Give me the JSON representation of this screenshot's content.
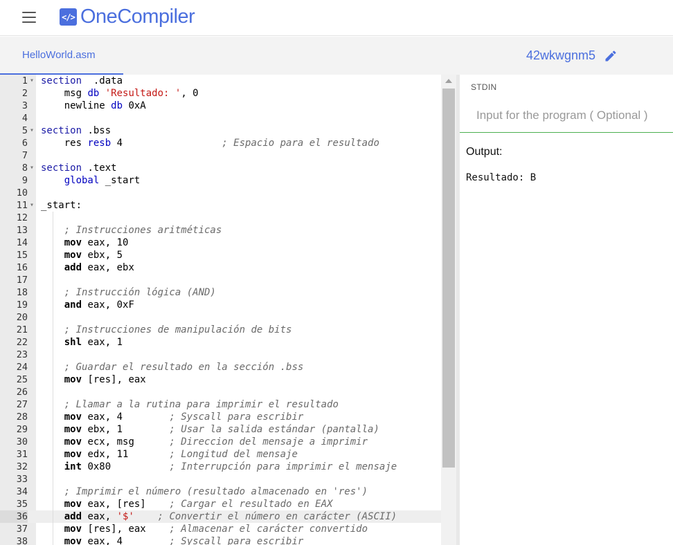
{
  "header": {
    "logo_glyph": "</>",
    "brand": "OneCompiler",
    "accent_color": "#4b6fde"
  },
  "subbar": {
    "file_tab": "HelloWorld.asm",
    "project_id": "42wkwgnm5"
  },
  "editor": {
    "lines": [
      {
        "n": "1",
        "fold": true,
        "tokens": [
          [
            "sec",
            "section"
          ],
          [
            "",
            "  .data"
          ]
        ]
      },
      {
        "n": "2",
        "tokens": [
          [
            "",
            "    msg "
          ],
          [
            "kw",
            "db"
          ],
          [
            "",
            ""
          ],
          [
            "str",
            " 'Resultado: '"
          ],
          [
            "",
            ", 0"
          ]
        ]
      },
      {
        "n": "3",
        "tokens": [
          [
            "",
            "    newline "
          ],
          [
            "kw",
            "db"
          ],
          [
            "",
            " 0xA"
          ]
        ]
      },
      {
        "n": "4",
        "tokens": []
      },
      {
        "n": "5",
        "fold": true,
        "tokens": [
          [
            "sec",
            "section"
          ],
          [
            "",
            " .bss"
          ]
        ]
      },
      {
        "n": "6",
        "tokens": [
          [
            "",
            "    res "
          ],
          [
            "kw",
            "resb"
          ],
          [
            "",
            " 4                 "
          ],
          [
            "cm",
            "; Espacio para el resultado"
          ]
        ]
      },
      {
        "n": "7",
        "tokens": []
      },
      {
        "n": "8",
        "fold": true,
        "tokens": [
          [
            "sec",
            "section"
          ],
          [
            "",
            " .text"
          ]
        ]
      },
      {
        "n": "9",
        "tokens": [
          [
            "",
            "    "
          ],
          [
            "kw",
            "global"
          ],
          [
            "",
            " _start"
          ]
        ]
      },
      {
        "n": "10",
        "tokens": []
      },
      {
        "n": "11",
        "fold": true,
        "tokens": [
          [
            "",
            "_start:"
          ]
        ]
      },
      {
        "n": "12",
        "tokens": []
      },
      {
        "n": "13",
        "tokens": [
          [
            "",
            "    "
          ],
          [
            "cm",
            "; Instrucciones aritméticas"
          ]
        ]
      },
      {
        "n": "14",
        "tokens": [
          [
            "",
            "    "
          ],
          [
            "ins",
            "mov"
          ],
          [
            "",
            " eax, 10"
          ]
        ]
      },
      {
        "n": "15",
        "tokens": [
          [
            "",
            "    "
          ],
          [
            "ins",
            "mov"
          ],
          [
            "",
            " ebx, 5"
          ]
        ]
      },
      {
        "n": "16",
        "tokens": [
          [
            "",
            "    "
          ],
          [
            "ins",
            "add"
          ],
          [
            "",
            " eax, ebx"
          ]
        ]
      },
      {
        "n": "17",
        "tokens": []
      },
      {
        "n": "18",
        "tokens": [
          [
            "",
            "    "
          ],
          [
            "cm",
            "; Instrucción lógica (AND)"
          ]
        ]
      },
      {
        "n": "19",
        "tokens": [
          [
            "",
            "    "
          ],
          [
            "ins",
            "and"
          ],
          [
            "",
            " eax, 0xF"
          ]
        ]
      },
      {
        "n": "20",
        "tokens": []
      },
      {
        "n": "21",
        "tokens": [
          [
            "",
            "    "
          ],
          [
            "cm",
            "; Instrucciones de manipulación de bits"
          ]
        ]
      },
      {
        "n": "22",
        "tokens": [
          [
            "",
            "    "
          ],
          [
            "ins",
            "shl"
          ],
          [
            "",
            " eax, 1"
          ]
        ]
      },
      {
        "n": "23",
        "tokens": []
      },
      {
        "n": "24",
        "tokens": [
          [
            "",
            "    "
          ],
          [
            "cm",
            "; Guardar el resultado en la sección .bss"
          ]
        ]
      },
      {
        "n": "25",
        "tokens": [
          [
            "",
            "    "
          ],
          [
            "ins",
            "mov"
          ],
          [
            "",
            " [res], eax"
          ]
        ]
      },
      {
        "n": "26",
        "tokens": []
      },
      {
        "n": "27",
        "tokens": [
          [
            "",
            "    "
          ],
          [
            "cm",
            "; Llamar a la rutina para imprimir el resultado"
          ]
        ]
      },
      {
        "n": "28",
        "tokens": [
          [
            "",
            "    "
          ],
          [
            "ins",
            "mov"
          ],
          [
            "",
            " eax, 4        "
          ],
          [
            "cm",
            "; Syscall para escribir"
          ]
        ]
      },
      {
        "n": "29",
        "tokens": [
          [
            "",
            "    "
          ],
          [
            "ins",
            "mov"
          ],
          [
            "",
            " ebx, 1        "
          ],
          [
            "cm",
            "; Usar la salida estándar (pantalla)"
          ]
        ]
      },
      {
        "n": "30",
        "tokens": [
          [
            "",
            "    "
          ],
          [
            "ins",
            "mov"
          ],
          [
            "",
            " ecx, msg      "
          ],
          [
            "cm",
            "; Direccion del mensaje a imprimir"
          ]
        ]
      },
      {
        "n": "31",
        "tokens": [
          [
            "",
            "    "
          ],
          [
            "ins",
            "mov"
          ],
          [
            "",
            " edx, 11       "
          ],
          [
            "cm",
            "; Longitud del mensaje"
          ]
        ]
      },
      {
        "n": "32",
        "tokens": [
          [
            "",
            "    "
          ],
          [
            "ins",
            "int"
          ],
          [
            "",
            " 0x80          "
          ],
          [
            "cm",
            "; Interrupción para imprimir el mensaje"
          ]
        ]
      },
      {
        "n": "33",
        "tokens": []
      },
      {
        "n": "34",
        "tokens": [
          [
            "",
            "    "
          ],
          [
            "cm",
            "; Imprimir el número (resultado almacenado en 'res')"
          ]
        ]
      },
      {
        "n": "35",
        "tokens": [
          [
            "",
            "    "
          ],
          [
            "ins",
            "mov"
          ],
          [
            "",
            " eax, [res]    "
          ],
          [
            "cm",
            "; Cargar el resultado en EAX"
          ]
        ]
      },
      {
        "n": "36",
        "active": true,
        "tokens": [
          [
            "",
            "    "
          ],
          [
            "ins",
            "add"
          ],
          [
            "",
            " eax, "
          ],
          [
            "str",
            "'$'"
          ],
          [
            "",
            "    "
          ],
          [
            "cm",
            "; Convertir el número en carácter (ASCII)"
          ]
        ]
      },
      {
        "n": "37",
        "tokens": [
          [
            "",
            "    "
          ],
          [
            "ins",
            "mov"
          ],
          [
            "",
            " [res], eax    "
          ],
          [
            "cm",
            "; Almacenar el carácter convertido"
          ]
        ]
      },
      {
        "n": "38",
        "tokens": [
          [
            "",
            "    "
          ],
          [
            "ins",
            "mov"
          ],
          [
            "",
            " eax, 4        "
          ],
          [
            "cm",
            "; Syscall para escribir"
          ]
        ]
      }
    ]
  },
  "right_panel": {
    "stdin_label": "STDIN",
    "stdin_placeholder": "Input for the program ( Optional )",
    "stdin_value": "",
    "output_label": "Output:",
    "output_text": "Resultado: B"
  }
}
